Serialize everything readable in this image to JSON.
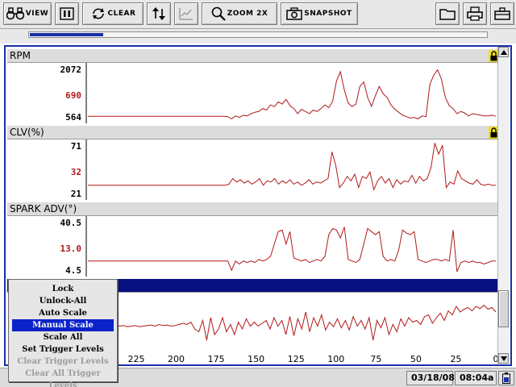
{
  "toolbar": {
    "view_label": "View",
    "clear_label": "Clear",
    "zoom_label": "Zoom 2x",
    "snapshot_label": "Snapshot"
  },
  "progress": {
    "fraction": 0.16
  },
  "strips": [
    {
      "title": "RPM",
      "max": "2072",
      "current": "690",
      "min": "564",
      "locked": true
    },
    {
      "title": "CLV(%)",
      "max": "71",
      "current": "32",
      "min": "21",
      "locked": true
    },
    {
      "title": "SPARK ADV(°)",
      "max": "40.5",
      "current": "13.0",
      "min": "4.5",
      "locked": false
    },
    {
      "title": "",
      "max": "",
      "current": "",
      "min": "",
      "locked": false,
      "selected": true
    }
  ],
  "x_axis": {
    "ticks": [
      "225",
      "200",
      "175",
      "150",
      "125",
      "100",
      "75",
      "50",
      "25",
      "0"
    ]
  },
  "context_menu": {
    "items": [
      {
        "label": "Lock",
        "state": "normal"
      },
      {
        "label": "Unlock-All",
        "state": "normal"
      },
      {
        "label": "Auto Scale",
        "state": "normal"
      },
      {
        "label": "Manual Scale",
        "state": "selected"
      },
      {
        "label": "Scale All",
        "state": "normal"
      },
      {
        "label": "Set Trigger Levels",
        "state": "normal"
      },
      {
        "label": "Clear Trigger Levels",
        "state": "disabled"
      },
      {
        "label": "Clear All Trigger Levels",
        "state": "disabled"
      }
    ]
  },
  "status": {
    "date": "03/18/08",
    "time": "08:04a"
  },
  "colors": {
    "accent": "#1a2fa8",
    "selected_header": "#06107e",
    "trace": "#b01818",
    "menu_highlight": "#0a23c8"
  },
  "chart_data": [
    {
      "type": "line",
      "title": "RPM",
      "x_ticks": [
        "225",
        "200",
        "175",
        "150",
        "125",
        "100",
        "75",
        "50",
        "25",
        "0"
      ],
      "ylim": [
        564,
        2072
      ],
      "series": [
        {
          "name": "RPM",
          "values": [
            690,
            690,
            690,
            690,
            690,
            690,
            690,
            690,
            690,
            690,
            690,
            690,
            690,
            690,
            690,
            690,
            690,
            690,
            690,
            690,
            690,
            690,
            690,
            690,
            690,
            690,
            690,
            690,
            690,
            690,
            690,
            690,
            690,
            690,
            690,
            690,
            680,
            620,
            700,
            660,
            720,
            700,
            760,
            800,
            820,
            900,
            860,
            1000,
            950,
            1080,
            1020,
            1150,
            980,
            900,
            760,
            880,
            820,
            760,
            860,
            820,
            900,
            1000,
            920,
            1100,
            1650,
            1900,
            1400,
            1050,
            950,
            1020,
            1500,
            1620,
            1200,
            960,
            1250,
            1500,
            1300,
            1200,
            1000,
            880,
            800,
            720,
            680,
            640,
            660,
            620,
            700,
            680,
            1550,
            1800,
            1950,
            1700,
            1200,
            980,
            900,
            760,
            820,
            780,
            700,
            760,
            740,
            720,
            700,
            700,
            720,
            690
          ]
        }
      ]
    },
    {
      "type": "line",
      "title": "CLV(%)",
      "x_ticks": [
        "225",
        "200",
        "175",
        "150",
        "125",
        "100",
        "75",
        "50",
        "25",
        "0"
      ],
      "ylim": [
        21,
        71
      ],
      "series": [
        {
          "name": "CLV(%)",
          "values": [
            32,
            32,
            32,
            32,
            32,
            32,
            32,
            32,
            32,
            32,
            32,
            32,
            32,
            32,
            32,
            32,
            32,
            32,
            32,
            32,
            32,
            32,
            32,
            32,
            32,
            32,
            32,
            32,
            32,
            32,
            32,
            32,
            32,
            32,
            32,
            32,
            32,
            33,
            38,
            35,
            37,
            34,
            36,
            33,
            35,
            38,
            32,
            36,
            35,
            38,
            33,
            36,
            34,
            37,
            33,
            35,
            32,
            34,
            37,
            33,
            35,
            34,
            36,
            38,
            62,
            50,
            30,
            34,
            40,
            36,
            42,
            30,
            40,
            38,
            44,
            28,
            36,
            40,
            34,
            38,
            30,
            37,
            33,
            36,
            35,
            41,
            34,
            40,
            36,
            38,
            48,
            70,
            60,
            68,
            30,
            35,
            33,
            45,
            38,
            36,
            34,
            33,
            37,
            33,
            32,
            33,
            32,
            32
          ]
        }
      ]
    },
    {
      "type": "line",
      "title": "SPARK ADV(°)",
      "x_ticks": [
        "225",
        "200",
        "175",
        "150",
        "125",
        "100",
        "75",
        "50",
        "25",
        "0"
      ],
      "ylim": [
        4.5,
        40.5
      ],
      "series": [
        {
          "name": "SPARK ADV(°)",
          "values": [
            13,
            13,
            13,
            13,
            13,
            13,
            13,
            13,
            13,
            13,
            13,
            13,
            13,
            13,
            13,
            13,
            13,
            13,
            13,
            13,
            13,
            13,
            13,
            13,
            13,
            13,
            13,
            13,
            13,
            13,
            13,
            13,
            13,
            13,
            13,
            13,
            13,
            7,
            13,
            11,
            13,
            12,
            13,
            12,
            14,
            13,
            14,
            16,
            24,
            32,
            33,
            24,
            32,
            15,
            14,
            13,
            14,
            12,
            13,
            14,
            13,
            16,
            30,
            34,
            33,
            28,
            35,
            14,
            13,
            12,
            14,
            24,
            34,
            32,
            30,
            32,
            16,
            13,
            14,
            13,
            20,
            33,
            31,
            30,
            32,
            14,
            13,
            12,
            13,
            14,
            14,
            13,
            14,
            13,
            33,
            6,
            12,
            13,
            12,
            13,
            12,
            12,
            11,
            12,
            13,
            13
          ]
        }
      ]
    },
    {
      "type": "line",
      "title": "",
      "x_ticks": [
        "225",
        "200",
        "175",
        "150",
        "125",
        "100",
        "75",
        "50",
        "25",
        "0"
      ],
      "ylim": [
        0,
        100
      ],
      "series": [
        {
          "name": "",
          "values": [
            45,
            45,
            46,
            45,
            47,
            46,
            48,
            47,
            45,
            46,
            44,
            45,
            46,
            44,
            45,
            46,
            47,
            45,
            48,
            46,
            47,
            45,
            46,
            48,
            50,
            48,
            52,
            40,
            35,
            55,
            20,
            60,
            30,
            40,
            60,
            35,
            48,
            30,
            52,
            40,
            58,
            45,
            52,
            45,
            50,
            55,
            40,
            60,
            45,
            55,
            30,
            62,
            28,
            58,
            40,
            70,
            35,
            60,
            45,
            65,
            38,
            52,
            44,
            58,
            42,
            55,
            38,
            62,
            45,
            55,
            40,
            60,
            20,
            55,
            42,
            60,
            30,
            48,
            35,
            58,
            45,
            60,
            52,
            55,
            48,
            62,
            65,
            50,
            60,
            68,
            55,
            72,
            65,
            80,
            70,
            75,
            78,
            72,
            80,
            76,
            82,
            75,
            78,
            70
          ]
        }
      ]
    }
  ]
}
